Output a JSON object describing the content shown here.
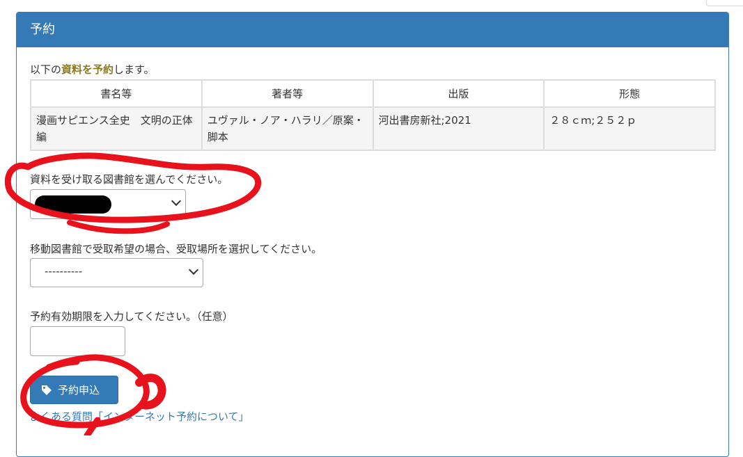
{
  "panel": {
    "title": "予約"
  },
  "intro": {
    "prefix": "以下の",
    "highlight": "資料を予約",
    "suffix": "します。"
  },
  "table": {
    "headers": [
      "書名等",
      "著者等",
      "出版",
      "形態"
    ],
    "row": {
      "title": "漫画サピエンス全史　文明の正体編",
      "author": "ユヴァル・ノア・ハラリ／原案・脚本",
      "publisher": "河出書房新社;2021",
      "format": "２８ｃｍ;２５２ｐ"
    }
  },
  "library_select": {
    "label": "資料を受け取る図書館を選んでください。",
    "value": ""
  },
  "mobile_select": {
    "label": "移動図書館で受取希望の場合、受取場所を選択してください。",
    "value": "----------"
  },
  "expiry": {
    "label": "予約有効期限を入力してください。（任意）",
    "value": ""
  },
  "submit": {
    "label": "予約申込"
  },
  "faq": {
    "label": "よくある質問「インターネット予約について」"
  },
  "colors": {
    "primary": "#337ab7",
    "highlight": "#8a7a22",
    "annotation": "#e8121c"
  },
  "icons": {
    "submit": "tag-icon",
    "select": "chevron-down-icon"
  }
}
